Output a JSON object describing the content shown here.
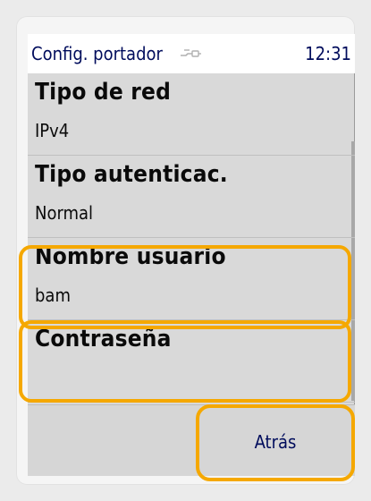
{
  "status": {
    "title": "Config. portador",
    "icon": "link-cable-icon",
    "time": "12:31"
  },
  "items": [
    {
      "title": "Tipo de red",
      "value": "IPv4"
    },
    {
      "title": "Tipo autenticac.",
      "value": "Normal"
    },
    {
      "title": "Nombre usuario",
      "value": "bam"
    },
    {
      "title": "Contraseña",
      "value": ""
    }
  ],
  "softkeys": {
    "back_label": "Atrás"
  },
  "colors": {
    "highlight": "#f5a800",
    "screen_background": "#d9d9d9",
    "status_text": "#000c5c"
  }
}
